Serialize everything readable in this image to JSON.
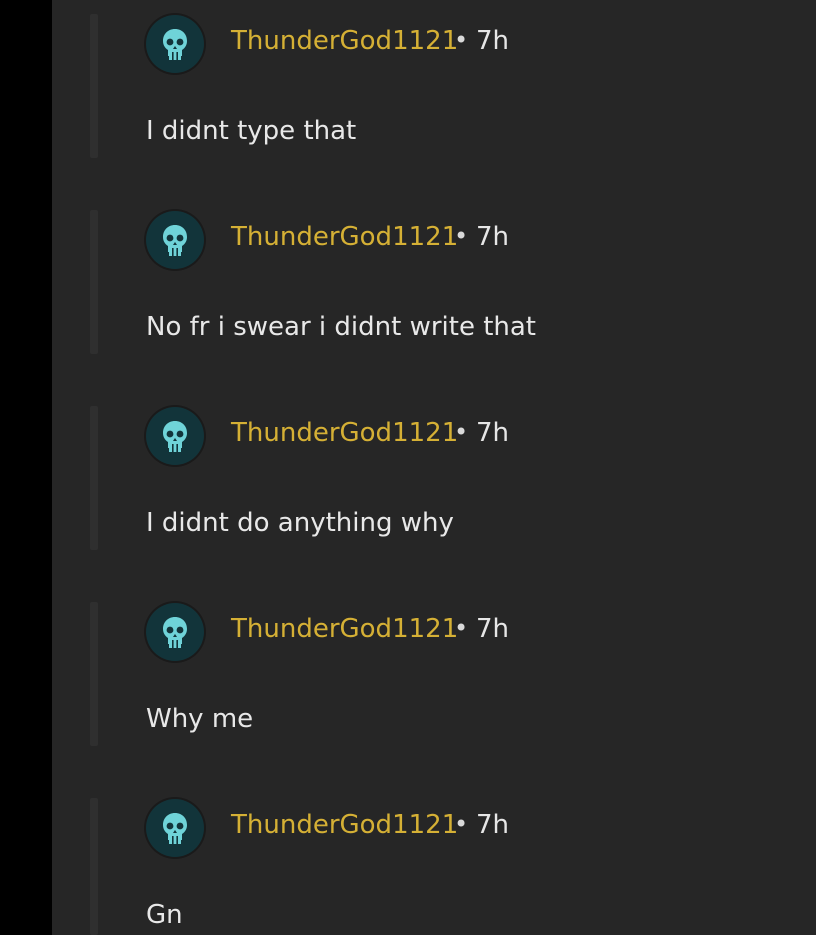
{
  "comments": [
    {
      "username": "ThunderGod1121",
      "separator": "•",
      "time": "7h",
      "text": "I didnt type that",
      "avatar_icon": "skull-icon"
    },
    {
      "username": "ThunderGod1121",
      "separator": "•",
      "time": "7h",
      "text": "No fr i swear i didnt write that",
      "avatar_icon": "skull-icon"
    },
    {
      "username": "ThunderGod1121",
      "separator": "•",
      "time": "7h",
      "text": "I didnt do anything why",
      "avatar_icon": "skull-icon"
    },
    {
      "username": "ThunderGod1121",
      "separator": "•",
      "time": "7h",
      "text": "Why me",
      "avatar_icon": "skull-icon"
    },
    {
      "username": "ThunderGod1121",
      "separator": "•",
      "time": "7h",
      "text": "Gn",
      "avatar_icon": "skull-icon"
    }
  ],
  "colors": {
    "background": "#262626",
    "username": "#d5b035",
    "text": "#e8e8e8",
    "avatar_bg": "#12343a",
    "skull": "#6fd3d8"
  }
}
